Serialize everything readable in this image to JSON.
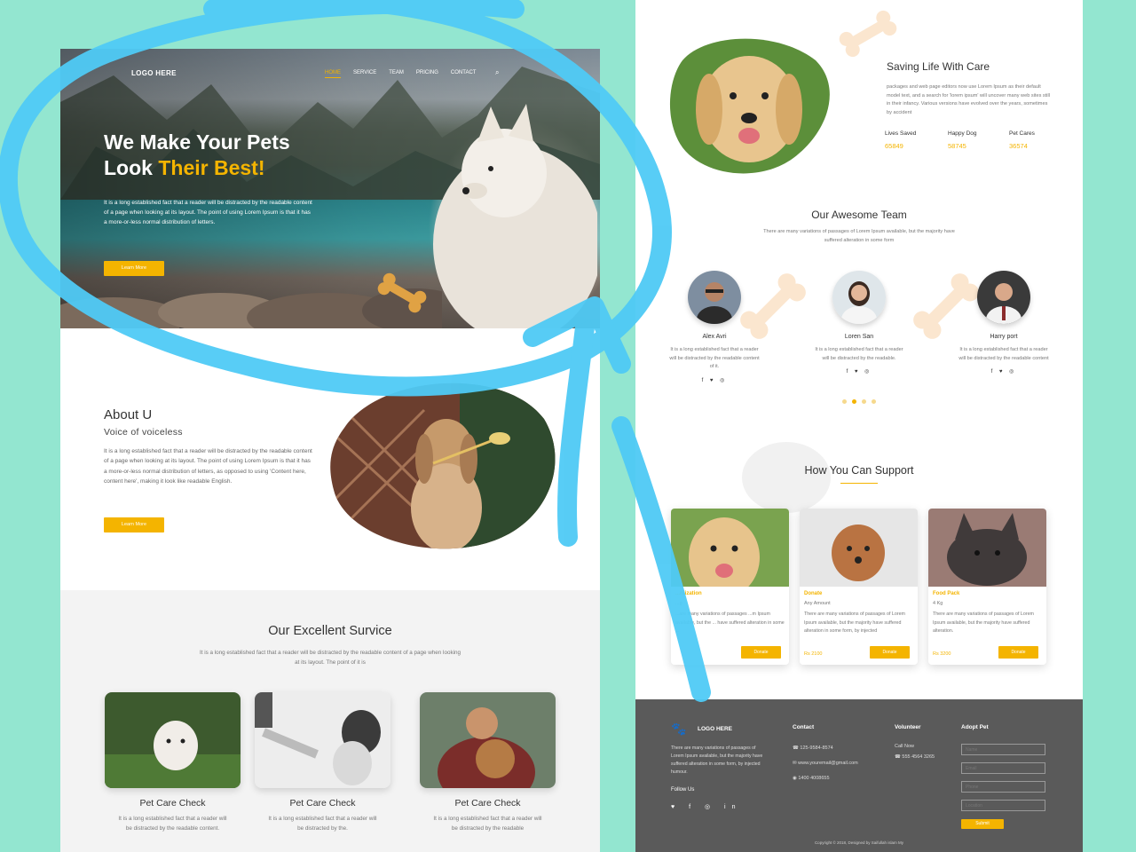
{
  "nav": {
    "logo": "LOGO HERE",
    "links": [
      "HOME",
      "SERVICE",
      "TEAM",
      "PRICING",
      "CONTACT"
    ]
  },
  "hero": {
    "title_line1": "We Make Your Pets",
    "title_line2_a": "Look ",
    "title_line2_b": "Their Best!",
    "text": "It is a long established fact that a reader will be distracted by the readable content of a page when looking at its layout. The point of using Lorem Ipsum is that it has a more-or-less normal distribution of letters.",
    "button": "Learn More"
  },
  "about": {
    "title": "About U",
    "subtitle": "Voice of voiceless",
    "text": "It is a long established fact that a reader will be distracted by the readable content of a page when looking at its layout. The point of using Lorem Ipsum is that it has a more-or-less normal distribution of letters, as opposed to using 'Content here, content here', making it look like readable English.",
    "button": "Learn More"
  },
  "service": {
    "title": "Our Excellent Survice",
    "subtitle": "It is a long established fact that a reader will be distracted by the readable content of a page when looking at its layout. The point of it is",
    "cards": [
      {
        "title": "Pet Care Check",
        "text": "It is a long established fact that a reader will be distracted by the readable content."
      },
      {
        "title": "Pet Care Check",
        "text": "It is a long established fact that a reader will be distracted by the."
      },
      {
        "title": "Pet Care Check",
        "text": "It is a long established fact that a reader will be distracted by the readable"
      }
    ]
  },
  "saving": {
    "title": "Saving Life With Care",
    "text": "packages and web page editors now use Lorem Ipsum as their default model text, and a search for 'lorem ipsum' will uncover many web sites still in their infancy. Various versions have evolved over the years, sometimes by accident",
    "stats": [
      {
        "label": "Lives Saved",
        "value": "65849"
      },
      {
        "label": "Happy Dog",
        "value": "58745"
      },
      {
        "label": "Pet Cares",
        "value": "36574"
      }
    ]
  },
  "team": {
    "title": "Our Awesome Team",
    "subtitle": "There are many variations of passages of Lorem Ipsum available, but the majority have suffered alteration in some form",
    "members": [
      {
        "name": "Alex Avri",
        "text": "It is a long established fact that a reader will be distracted by the readable content of it."
      },
      {
        "name": "Loren San",
        "text": "It is a long established fact that a reader will be distracted by the readable."
      },
      {
        "name": "Harry port",
        "text": "It is a long established fact that a reader will be distracted by the readable content"
      }
    ],
    "social": "f ♥ ◎"
  },
  "support": {
    "title": "How You Can Support",
    "cards": [
      {
        "title": "...rilization",
        "sub": "...g",
        "text": "...are many variations of passages ...m Ipsum available, but the ... have suffered alteration in some ...",
        "amount": "",
        "button": "Donate"
      },
      {
        "title": "Donate",
        "sub": "Any Amount",
        "text": "There are many variations of passages of Lorem Ipsum available, but the majority have suffered alteration in some form, by injected",
        "amount": "Rs 2100",
        "button": "Donate"
      },
      {
        "title": "Food Pack",
        "sub": "4 Kg",
        "text": "There are many variations of passages of Lorem Ipsum available, but the majority have suffered alteration.",
        "amount": "Rs 3200",
        "button": "Donate"
      }
    ]
  },
  "footer": {
    "logo": "LOGO HERE",
    "about": "There are many variations of passages of Lorem Ipsum available, but the majority have suffered alteration in some form, by injected humour.",
    "follow": "Follow Us",
    "contact_title": "Contact",
    "phone": "125-9584-8574",
    "email": "www.youremail@gmail.com",
    "address": "1400 4008655",
    "volunteer_title": "Volunteer",
    "call_now": "Call Now",
    "volunteer_phone": "555 4564 3265",
    "adopt_title": "Adopt Pet",
    "fields": [
      "Name",
      "Email",
      "Phone",
      "Location"
    ],
    "button": "Submit",
    "copyright": "Copyright © 2018, Designed by Saifullah islam My"
  }
}
